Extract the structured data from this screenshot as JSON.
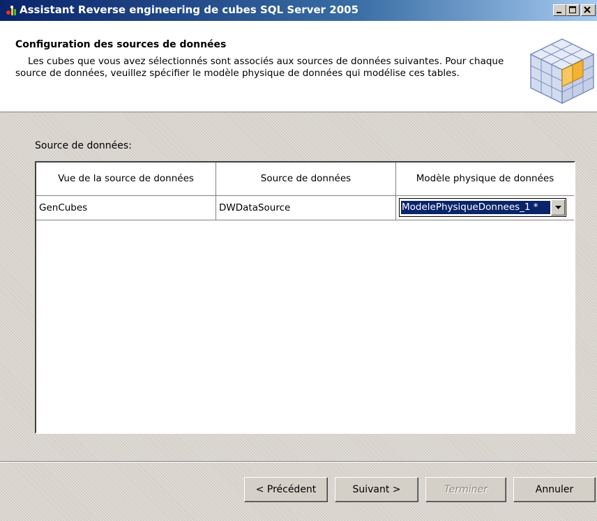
{
  "window": {
    "title": "Assistant Reverse engineering de cubes SQL Server 2005"
  },
  "header": {
    "title": "Configuration des sources de données",
    "description": "Les cubes que vous avez sélectionnés sont associés aux sources de données suivantes. Pour chaque source de données, veuillez spécifier le modèle physique de données qui modélise ces tables."
  },
  "main": {
    "label": "Source de données:",
    "table": {
      "columns": [
        "Vue de la source de données",
        "Source de données",
        "Modèle physique de données"
      ],
      "rows": [
        {
          "view": "GenCubes",
          "source": "DWDataSource",
          "model": "ModelePhysiqueDonnees_1 *"
        }
      ]
    }
  },
  "buttons": {
    "previous": "< Précédent",
    "next": "Suivant >",
    "finish": "Terminer",
    "cancel": "Annuler"
  },
  "icons": {
    "app": "app-icon",
    "cube": "cube-icon",
    "minimize": "minimize-icon",
    "maximize": "maximize-icon",
    "close": "close-icon",
    "dropdown": "chevron-down-icon"
  }
}
